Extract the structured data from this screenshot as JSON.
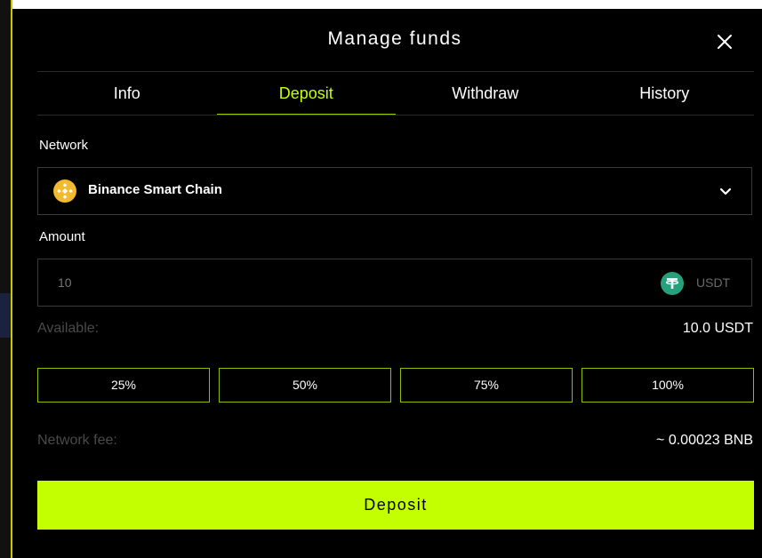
{
  "modal": {
    "title": "Manage funds"
  },
  "tabs": [
    {
      "label": "Info",
      "active": false
    },
    {
      "label": "Deposit",
      "active": true
    },
    {
      "label": "Withdraw",
      "active": false
    },
    {
      "label": "History",
      "active": false
    }
  ],
  "network": {
    "label": "Network",
    "selected": "Binance Smart Chain",
    "icon": "bnb-coin-icon"
  },
  "amount": {
    "label": "Amount",
    "value": "",
    "placeholder": "10",
    "currency": "USDT",
    "currency_icon": "tether-icon"
  },
  "available": {
    "label": "Available:",
    "value": "10.0 USDT"
  },
  "percent_buttons": [
    "25%",
    "50%",
    "75%",
    "100%"
  ],
  "fee": {
    "label": "Network fee:",
    "value": "~ 0.00023 BNB"
  },
  "submit": {
    "label": "Deposit"
  },
  "colors": {
    "accent": "#c4ff00",
    "background": "#000000",
    "text": "#ffffff",
    "muted": "#4a4a4a",
    "bnb": "#f3ba2f",
    "tether": "#26a17b"
  }
}
